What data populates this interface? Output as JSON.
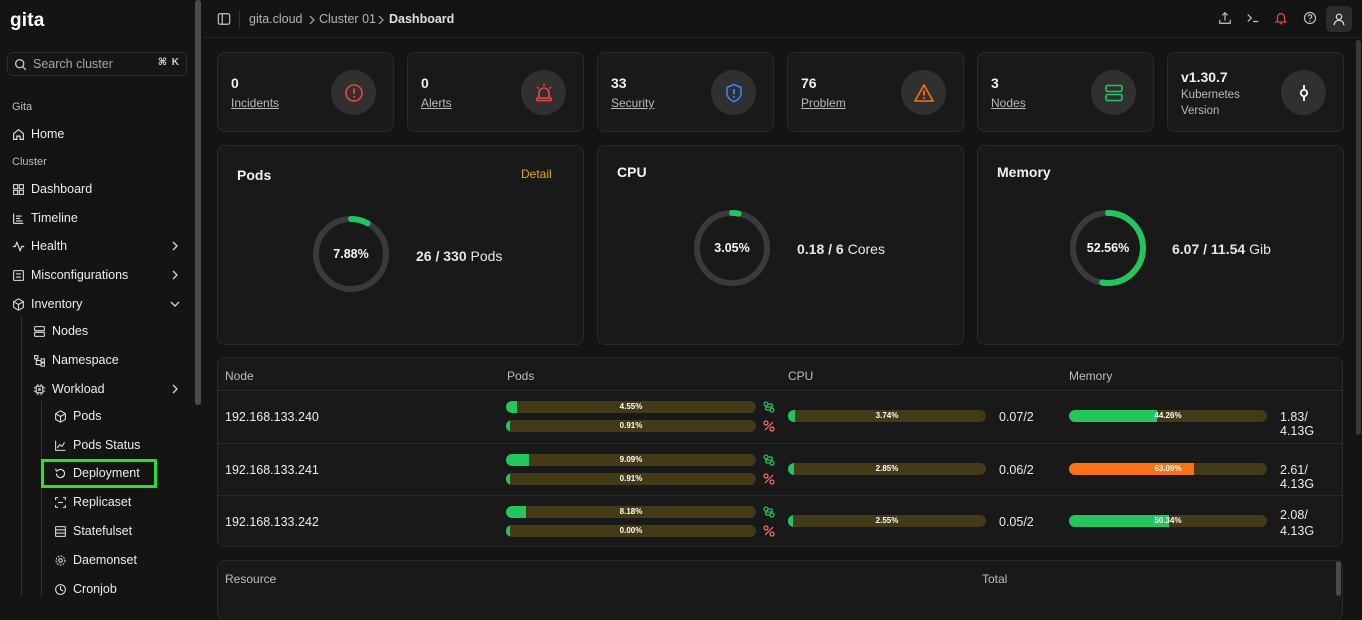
{
  "brand": {
    "logo": "gita"
  },
  "search": {
    "placeholder": "Search cluster",
    "shortcut": "⌘ K"
  },
  "sidebar": {
    "section_gita": "Gita",
    "home": "Home",
    "section_cluster": "Cluster",
    "dashboard": "Dashboard",
    "timeline": "Timeline",
    "health": "Health",
    "misconfigurations": "Misconfigurations",
    "inventory": "Inventory",
    "nodes": "Nodes",
    "namespace": "Namespace",
    "workload": "Workload",
    "pods": "Pods",
    "pods_status": "Pods Status",
    "deployment": "Deployment",
    "replicaset": "Replicaset",
    "statefulset": "Statefulset",
    "daemonset": "Daemonset",
    "cronjob": "Cronjob"
  },
  "breadcrumb": {
    "root": "gita.cloud",
    "cluster": "Cluster 01",
    "current": "Dashboard"
  },
  "stats": [
    {
      "value": "0",
      "label": "Incidents",
      "icon": "alert-circle-icon",
      "color": "#ef4444"
    },
    {
      "value": "0",
      "label": "Alerts",
      "icon": "siren-icon",
      "color": "#ef4444"
    },
    {
      "value": "33",
      "label": "Security",
      "icon": "shield-alert-icon",
      "color": "#3b82f6"
    },
    {
      "value": "76",
      "label": "Problem",
      "icon": "warning-triangle-icon",
      "color": "#f97316"
    },
    {
      "value": "3",
      "label": "Nodes",
      "icon": "server-icon",
      "color": "#22c55e"
    },
    {
      "value": "v1.30.7",
      "label": "Kubernetes Version",
      "icon": "git-commit-icon",
      "color": "#ffffff"
    }
  ],
  "gauges": {
    "pods": {
      "title": "Pods",
      "detail": "Detail",
      "percent_label": "7.88%",
      "fraction": 0.0788,
      "used": "26 / 330",
      "unit": "Pods"
    },
    "cpu": {
      "title": "CPU",
      "percent_label": "3.05%",
      "fraction": 0.0305,
      "used": "0.18 / 6",
      "unit": "Cores"
    },
    "memory": {
      "title": "Memory",
      "percent_label": "52.56%",
      "fraction": 0.5256,
      "used": "6.07 / 11.54",
      "unit": "Gib"
    }
  },
  "nodes_table": {
    "headers": {
      "node": "Node",
      "pods": "Pods",
      "cpu": "CPU",
      "memory": "Memory"
    },
    "rows": [
      {
        "node": "192.168.133.240",
        "pods_running": {
          "label": "4.55%",
          "fraction": 0.0455
        },
        "pods_failed": {
          "label": "0.91%",
          "fraction": 0.0091
        },
        "cpu": {
          "label": "3.74%",
          "fraction": 0.0374
        },
        "cpu_value": "0.07/2",
        "memory": {
          "label": "44.26%",
          "fraction": 0.4426,
          "color": "#22c55e"
        },
        "memory_value": "1.83/ 4.13G"
      },
      {
        "node": "192.168.133.241",
        "pods_running": {
          "label": "9.09%",
          "fraction": 0.0909
        },
        "pods_failed": {
          "label": "0.91%",
          "fraction": 0.0091
        },
        "cpu": {
          "label": "2.85%",
          "fraction": 0.0285
        },
        "cpu_value": "0.06/2",
        "memory": {
          "label": "63.09%",
          "fraction": 0.6309,
          "color": "#f97316"
        },
        "memory_value": "2.61/ 4.13G"
      },
      {
        "node": "192.168.133.242",
        "pods_running": {
          "label": "8.18%",
          "fraction": 0.0818
        },
        "pods_failed": {
          "label": "0.00%",
          "fraction": 0.0
        },
        "cpu": {
          "label": "2.55%",
          "fraction": 0.0255
        },
        "cpu_value": "0.05/2",
        "memory": {
          "label": "50.34%",
          "fraction": 0.5034,
          "color": "#22c55e"
        },
        "memory_value_line1": "2.08/",
        "memory_value_line2": "4.13G"
      }
    ]
  },
  "resource_table": {
    "headers": {
      "resource": "Resource",
      "total": "Total"
    }
  },
  "colors": {
    "accent_green": "#22c55e",
    "danger": "#ef4444",
    "warning": "#f97316",
    "info": "#3b82f6",
    "detail": "#e3a800",
    "highlight": "#27e12c"
  }
}
